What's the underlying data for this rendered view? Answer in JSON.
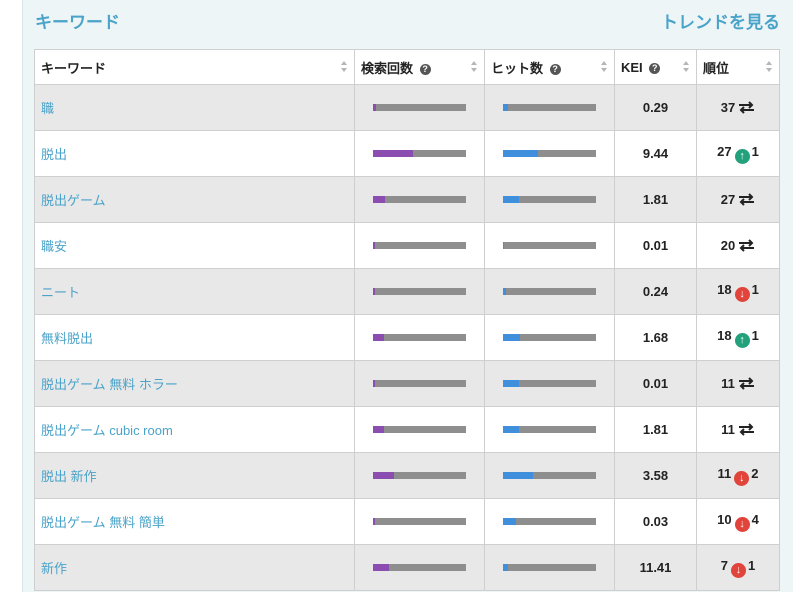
{
  "panel": {
    "title": "キーワード",
    "trend_link": "トレンドを見る"
  },
  "table": {
    "headers": {
      "keyword": "キーワード",
      "search_volume": "検索回数",
      "hits": "ヒット数",
      "kei": "KEI",
      "rank": "順位"
    },
    "help_icon": "?",
    "rows": [
      {
        "keyword": "職",
        "search_fraction": 0.03,
        "hits_fraction": 0.05,
        "kei": "0.29",
        "rank": "37",
        "change": "same",
        "change_amount": ""
      },
      {
        "keyword": "脱出",
        "search_fraction": 0.43,
        "hits_fraction": 0.38,
        "kei": "9.44",
        "rank": "27",
        "change": "up",
        "change_amount": "1"
      },
      {
        "keyword": "脱出ゲーム",
        "search_fraction": 0.13,
        "hits_fraction": 0.17,
        "kei": "1.81",
        "rank": "27",
        "change": "same",
        "change_amount": ""
      },
      {
        "keyword": "職安",
        "search_fraction": 0.02,
        "hits_fraction": 0.01,
        "kei": "0.01",
        "rank": "20",
        "change": "same",
        "change_amount": ""
      },
      {
        "keyword": "ニート",
        "search_fraction": 0.02,
        "hits_fraction": 0.03,
        "kei": "0.24",
        "rank": "18",
        "change": "down",
        "change_amount": "1"
      },
      {
        "keyword": "無料脱出",
        "search_fraction": 0.12,
        "hits_fraction": 0.18,
        "kei": "1.68",
        "rank": "18",
        "change": "up",
        "change_amount": "1"
      },
      {
        "keyword": "脱出ゲーム 無料 ホラー",
        "search_fraction": 0.02,
        "hits_fraction": 0.17,
        "kei": "0.01",
        "rank": "11",
        "change": "same",
        "change_amount": ""
      },
      {
        "keyword": "脱出ゲーム cubic room",
        "search_fraction": 0.12,
        "hits_fraction": 0.17,
        "kei": "1.81",
        "rank": "11",
        "change": "same",
        "change_amount": ""
      },
      {
        "keyword": "脱出 新作",
        "search_fraction": 0.23,
        "hits_fraction": 0.32,
        "kei": "3.58",
        "rank": "11",
        "change": "down",
        "change_amount": "2"
      },
      {
        "keyword": "脱出ゲーム 無料 簡単",
        "search_fraction": 0.02,
        "hits_fraction": 0.14,
        "kei": "0.03",
        "rank": "10",
        "change": "down",
        "change_amount": "4"
      },
      {
        "keyword": "新作",
        "search_fraction": 0.17,
        "hits_fraction": 0.05,
        "kei": "11.41",
        "rank": "7",
        "change": "down",
        "change_amount": "1"
      }
    ]
  },
  "colors": {
    "accent": "#4aa3c9",
    "search_bar": "#8b4db0",
    "hits_bar": "#3f8fdc",
    "track": "#8e8e8e",
    "rank_up": "#23a07c",
    "rank_down": "#e0443a"
  },
  "icons": {
    "help": "help-circle-icon",
    "sort": "sort-icon",
    "same": "swap-arrows-icon",
    "up": "arrow-up-circle-icon",
    "down": "arrow-down-circle-icon"
  }
}
